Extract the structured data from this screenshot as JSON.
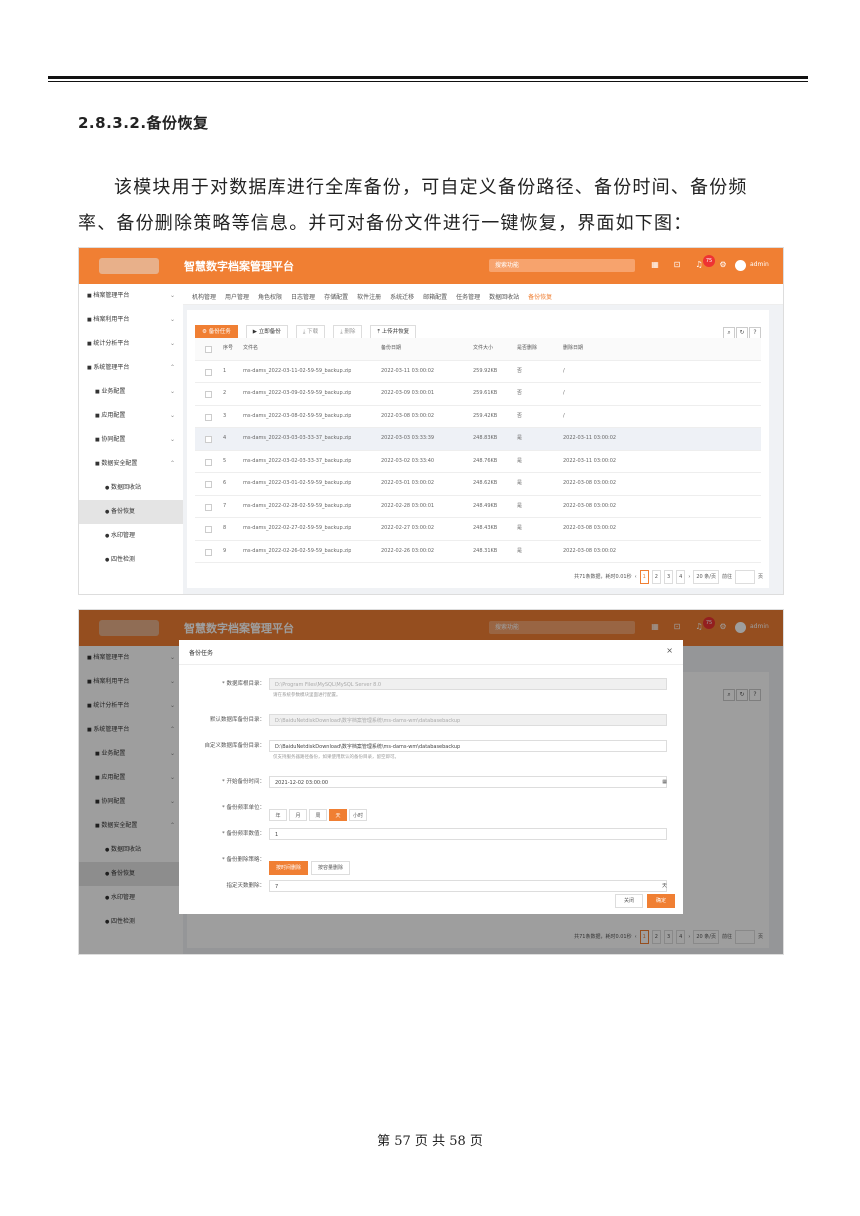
{
  "heading": "2.8.3.2.备份恢复",
  "paragraph": "该模块用于对数据库进行全库备份，可自定义备份路径、备份时间、备份频率、备份删除策略等信息。并可对备份文件进行一键恢复，界面如下图：",
  "footer": "第 57 页 共 58 页",
  "app": {
    "title": "智慧数字档案管理平台",
    "search_placeholder": "搜索功能",
    "badge": "75",
    "user": "admin",
    "colors": {
      "accent": "#f07f33"
    }
  },
  "sidebar": [
    {
      "label": "档案管理平台",
      "level": 0,
      "chev": "⌄"
    },
    {
      "label": "档案利用平台",
      "level": 0,
      "chev": "⌄"
    },
    {
      "label": "统计分析平台",
      "level": 0,
      "chev": "⌄"
    },
    {
      "label": "系统管理平台",
      "level": 0,
      "chev": "⌃"
    },
    {
      "label": "业务配置",
      "level": 1,
      "chev": "⌄"
    },
    {
      "label": "应用配置",
      "level": 1,
      "chev": "⌄"
    },
    {
      "label": "协同配置",
      "level": 1,
      "chev": "⌄"
    },
    {
      "label": "数据安全配置",
      "level": 1,
      "chev": "⌃"
    },
    {
      "label": "数据回收站",
      "level": 2,
      "chev": ""
    },
    {
      "label": "备份恢复",
      "level": 2,
      "chev": "",
      "active": true
    },
    {
      "label": "水印管理",
      "level": 2,
      "chev": ""
    },
    {
      "label": "四性检测",
      "level": 2,
      "chev": ""
    }
  ],
  "tabs": [
    "机构管理",
    "用户管理",
    "角色权限",
    "日志管理",
    "存储配置",
    "软件注册",
    "系统迁移",
    "邮箱配置",
    "任务管理",
    "数据回收站",
    "备份恢复"
  ],
  "toolbar": {
    "task": "备份任务",
    "backup_now": "立即备份",
    "download": "下载",
    "delete": "删除",
    "upload_restore": "上传并恢复"
  },
  "table": {
    "headers": [
      "序号",
      "文件名",
      "备份日期",
      "文件大小",
      "是否删除",
      "删除日期"
    ],
    "rows": [
      [
        "1",
        "ms-dams_2022-03-11-02-59-59_backup.zip",
        "2022-03-11 03:00:02",
        "259.92KB",
        "否",
        "/"
      ],
      [
        "2",
        "ms-dams_2022-03-09-02-59-59_backup.zip",
        "2022-03-09 03:00:01",
        "259.61KB",
        "否",
        "/"
      ],
      [
        "3",
        "ms-dams_2022-03-08-02-59-59_backup.zip",
        "2022-03-08 03:00:02",
        "259.42KB",
        "否",
        "/"
      ],
      [
        "4",
        "ms-dams_2022-03-03-03-33-37_backup.zip",
        "2022-03-03 03:33:39",
        "248.83KB",
        "是",
        "2022-03-11 03:00:02"
      ],
      [
        "5",
        "ms-dams_2022-03-02-03-33-37_backup.zip",
        "2022-03-02 03:33:40",
        "248.76KB",
        "是",
        "2022-03-11 03:00:02"
      ],
      [
        "6",
        "ms-dams_2022-03-01-02-59-59_backup.zip",
        "2022-03-01 03:00:02",
        "248.62KB",
        "是",
        "2022-03-08 03:00:02"
      ],
      [
        "7",
        "ms-dams_2022-02-28-02-59-59_backup.zip",
        "2022-02-28 03:00:01",
        "248.49KB",
        "是",
        "2022-03-08 03:00:02"
      ],
      [
        "8",
        "ms-dams_2022-02-27-02-59-59_backup.zip",
        "2022-02-27 03:00:02",
        "248.43KB",
        "是",
        "2022-03-08 03:00:02"
      ],
      [
        "9",
        "ms-dams_2022-02-26-02-59-59_backup.zip",
        "2022-02-26 03:00:02",
        "248.31KB",
        "是",
        "2022-03-08 03:00:02"
      ]
    ]
  },
  "pager": {
    "summary": "共71条数据，耗时0.01秒",
    "pages": [
      "1",
      "2",
      "3",
      "4"
    ],
    "per_page": "20 条/页",
    "goto": "前往",
    "page_unit": "页"
  },
  "modal": {
    "title": "备份任务",
    "close": "×",
    "fields": {
      "db_root_label": "* 数据库根目录：",
      "db_root_value": "D:\\Program Files\\MySQL\\MySQL Server 8.0",
      "db_root_hint": "请在系统参数模块里面进行配置。",
      "default_dir_label": "默认数据库备份目录：",
      "default_dir_value": "D:\\BaiduNetdiskDownload\\数字档案管理系统\\ms-dams-wm\\databasebackup",
      "custom_dir_label": "自定义数据库备份目录：",
      "custom_dir_value": "D:\\BaiduNetdiskDownload\\数字档案管理系统\\ms-dams-wm\\databasebackup",
      "custom_dir_hint": "仅支持服务器路径备份，如果使用默认的备份目录，留空即可。",
      "start_time_label": "* 开始备份时间：",
      "start_time_value": "2021-12-02 03:00:00",
      "freq_unit_label": "* 备份频率单位：",
      "freq_units": [
        "年",
        "月",
        "周",
        "天",
        "小时"
      ],
      "freq_value_label": "* 备份频率数值：",
      "freq_value": "1",
      "delete_policy_label": "* 备份删除策略：",
      "delete_policies": [
        "按时间删除",
        "按容量删除"
      ],
      "keep_days_label": "指定天数删除：",
      "keep_days_value": "7",
      "keep_days_unit": "天"
    },
    "cancel": "关闭",
    "ok": "确定"
  }
}
